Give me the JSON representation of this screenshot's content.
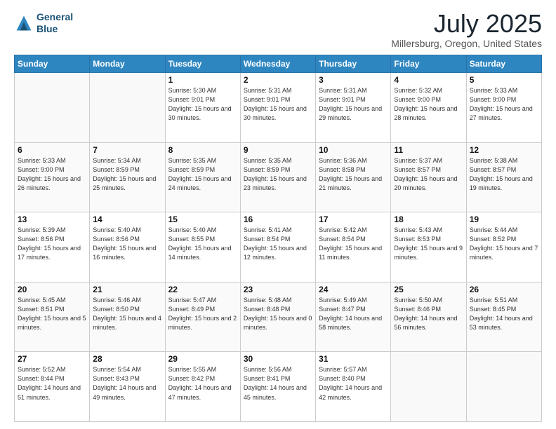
{
  "header": {
    "logo_line1": "General",
    "logo_line2": "Blue",
    "title": "July 2025",
    "subtitle": "Millersburg, Oregon, United States"
  },
  "days_of_week": [
    "Sunday",
    "Monday",
    "Tuesday",
    "Wednesday",
    "Thursday",
    "Friday",
    "Saturday"
  ],
  "weeks": [
    [
      {
        "day": "",
        "info": ""
      },
      {
        "day": "",
        "info": ""
      },
      {
        "day": "1",
        "info": "Sunrise: 5:30 AM\nSunset: 9:01 PM\nDaylight: 15 hours\nand 30 minutes."
      },
      {
        "day": "2",
        "info": "Sunrise: 5:31 AM\nSunset: 9:01 PM\nDaylight: 15 hours\nand 30 minutes."
      },
      {
        "day": "3",
        "info": "Sunrise: 5:31 AM\nSunset: 9:01 PM\nDaylight: 15 hours\nand 29 minutes."
      },
      {
        "day": "4",
        "info": "Sunrise: 5:32 AM\nSunset: 9:00 PM\nDaylight: 15 hours\nand 28 minutes."
      },
      {
        "day": "5",
        "info": "Sunrise: 5:33 AM\nSunset: 9:00 PM\nDaylight: 15 hours\nand 27 minutes."
      }
    ],
    [
      {
        "day": "6",
        "info": "Sunrise: 5:33 AM\nSunset: 9:00 PM\nDaylight: 15 hours\nand 26 minutes."
      },
      {
        "day": "7",
        "info": "Sunrise: 5:34 AM\nSunset: 8:59 PM\nDaylight: 15 hours\nand 25 minutes."
      },
      {
        "day": "8",
        "info": "Sunrise: 5:35 AM\nSunset: 8:59 PM\nDaylight: 15 hours\nand 24 minutes."
      },
      {
        "day": "9",
        "info": "Sunrise: 5:35 AM\nSunset: 8:59 PM\nDaylight: 15 hours\nand 23 minutes."
      },
      {
        "day": "10",
        "info": "Sunrise: 5:36 AM\nSunset: 8:58 PM\nDaylight: 15 hours\nand 21 minutes."
      },
      {
        "day": "11",
        "info": "Sunrise: 5:37 AM\nSunset: 8:57 PM\nDaylight: 15 hours\nand 20 minutes."
      },
      {
        "day": "12",
        "info": "Sunrise: 5:38 AM\nSunset: 8:57 PM\nDaylight: 15 hours\nand 19 minutes."
      }
    ],
    [
      {
        "day": "13",
        "info": "Sunrise: 5:39 AM\nSunset: 8:56 PM\nDaylight: 15 hours\nand 17 minutes."
      },
      {
        "day": "14",
        "info": "Sunrise: 5:40 AM\nSunset: 8:56 PM\nDaylight: 15 hours\nand 16 minutes."
      },
      {
        "day": "15",
        "info": "Sunrise: 5:40 AM\nSunset: 8:55 PM\nDaylight: 15 hours\nand 14 minutes."
      },
      {
        "day": "16",
        "info": "Sunrise: 5:41 AM\nSunset: 8:54 PM\nDaylight: 15 hours\nand 12 minutes."
      },
      {
        "day": "17",
        "info": "Sunrise: 5:42 AM\nSunset: 8:54 PM\nDaylight: 15 hours\nand 11 minutes."
      },
      {
        "day": "18",
        "info": "Sunrise: 5:43 AM\nSunset: 8:53 PM\nDaylight: 15 hours\nand 9 minutes."
      },
      {
        "day": "19",
        "info": "Sunrise: 5:44 AM\nSunset: 8:52 PM\nDaylight: 15 hours\nand 7 minutes."
      }
    ],
    [
      {
        "day": "20",
        "info": "Sunrise: 5:45 AM\nSunset: 8:51 PM\nDaylight: 15 hours\nand 5 minutes."
      },
      {
        "day": "21",
        "info": "Sunrise: 5:46 AM\nSunset: 8:50 PM\nDaylight: 15 hours\nand 4 minutes."
      },
      {
        "day": "22",
        "info": "Sunrise: 5:47 AM\nSunset: 8:49 PM\nDaylight: 15 hours\nand 2 minutes."
      },
      {
        "day": "23",
        "info": "Sunrise: 5:48 AM\nSunset: 8:48 PM\nDaylight: 15 hours\nand 0 minutes."
      },
      {
        "day": "24",
        "info": "Sunrise: 5:49 AM\nSunset: 8:47 PM\nDaylight: 14 hours\nand 58 minutes."
      },
      {
        "day": "25",
        "info": "Sunrise: 5:50 AM\nSunset: 8:46 PM\nDaylight: 14 hours\nand 56 minutes."
      },
      {
        "day": "26",
        "info": "Sunrise: 5:51 AM\nSunset: 8:45 PM\nDaylight: 14 hours\nand 53 minutes."
      }
    ],
    [
      {
        "day": "27",
        "info": "Sunrise: 5:52 AM\nSunset: 8:44 PM\nDaylight: 14 hours\nand 51 minutes."
      },
      {
        "day": "28",
        "info": "Sunrise: 5:54 AM\nSunset: 8:43 PM\nDaylight: 14 hours\nand 49 minutes."
      },
      {
        "day": "29",
        "info": "Sunrise: 5:55 AM\nSunset: 8:42 PM\nDaylight: 14 hours\nand 47 minutes."
      },
      {
        "day": "30",
        "info": "Sunrise: 5:56 AM\nSunset: 8:41 PM\nDaylight: 14 hours\nand 45 minutes."
      },
      {
        "day": "31",
        "info": "Sunrise: 5:57 AM\nSunset: 8:40 PM\nDaylight: 14 hours\nand 42 minutes."
      },
      {
        "day": "",
        "info": ""
      },
      {
        "day": "",
        "info": ""
      }
    ]
  ]
}
